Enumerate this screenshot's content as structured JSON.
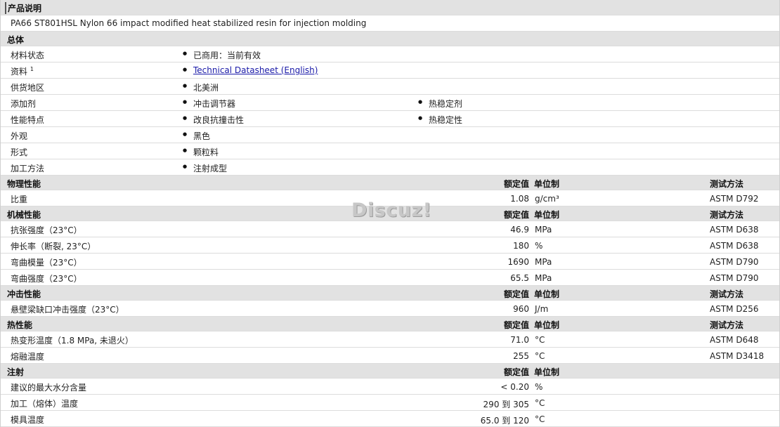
{
  "title": "产品说明",
  "description": "PA66 ST801HSL Nylon 66 impact modified heat stabilized resin for injection molding",
  "general": {
    "header": "总体",
    "status_label": "材料状态",
    "status_value": "已商用：当前有效",
    "literature_label": "资料",
    "literature_sup": "1",
    "literature_link": "Technical Datasheet (English)",
    "availability_label": "供货地区",
    "availability_value": "北美洲",
    "additive_label": "添加剂",
    "additive_values": [
      "冲击调节器",
      "热稳定剂"
    ],
    "features_label": "性能特点",
    "features_values": [
      "改良抗撞击性",
      "热稳定性"
    ],
    "appearance_label": "外观",
    "appearance_value": "黑色",
    "form_label": "形式",
    "form_value": "颗粒料",
    "processing_label": "加工方法",
    "processing_value": "注射成型"
  },
  "columns": {
    "nominal": "额定值",
    "unit": "单位制",
    "test": "测试方法"
  },
  "physical": {
    "header": "物理性能",
    "rows": [
      {
        "name": "比重",
        "value": "1.08",
        "unit": "g/cm³",
        "test": "ASTM D792"
      }
    ]
  },
  "mechanical": {
    "header": "机械性能",
    "rows": [
      {
        "name": "抗张强度（23°C）",
        "value": "46.9",
        "unit": "MPa",
        "test": "ASTM D638"
      },
      {
        "name": "伸长率（断裂, 23°C）",
        "value": "180",
        "unit": "%",
        "test": "ASTM D638"
      },
      {
        "name": "弯曲模量（23°C）",
        "value": "1690",
        "unit": "MPa",
        "test": "ASTM D790"
      },
      {
        "name": "弯曲强度（23°C）",
        "value": "65.5",
        "unit": "MPa",
        "test": "ASTM D790"
      }
    ]
  },
  "impact": {
    "header": "冲击性能",
    "rows": [
      {
        "name": "悬壁梁缺口冲击强度（23°C）",
        "value": "960",
        "unit": "J/m",
        "test": "ASTM D256"
      }
    ]
  },
  "thermal": {
    "header": "热性能",
    "rows": [
      {
        "name": "热变形温度（1.8 MPa, 未退火）",
        "value": "71.0",
        "unit": "°C",
        "test": "ASTM D648"
      },
      {
        "name": "熔融温度",
        "value": "255",
        "unit": "°C",
        "test": "ASTM D3418"
      }
    ]
  },
  "injection": {
    "header": "注射",
    "rows": [
      {
        "name": "建议的最大水分含量",
        "value": "< 0.20",
        "unit": "%",
        "test": ""
      },
      {
        "name": "加工（熔体）温度",
        "value": "290 到  305",
        "unit": "°C",
        "test": ""
      },
      {
        "name": "模具温度",
        "value": "65.0 到  120",
        "unit": "°C",
        "test": ""
      }
    ]
  },
  "watermark": "Discuz!"
}
